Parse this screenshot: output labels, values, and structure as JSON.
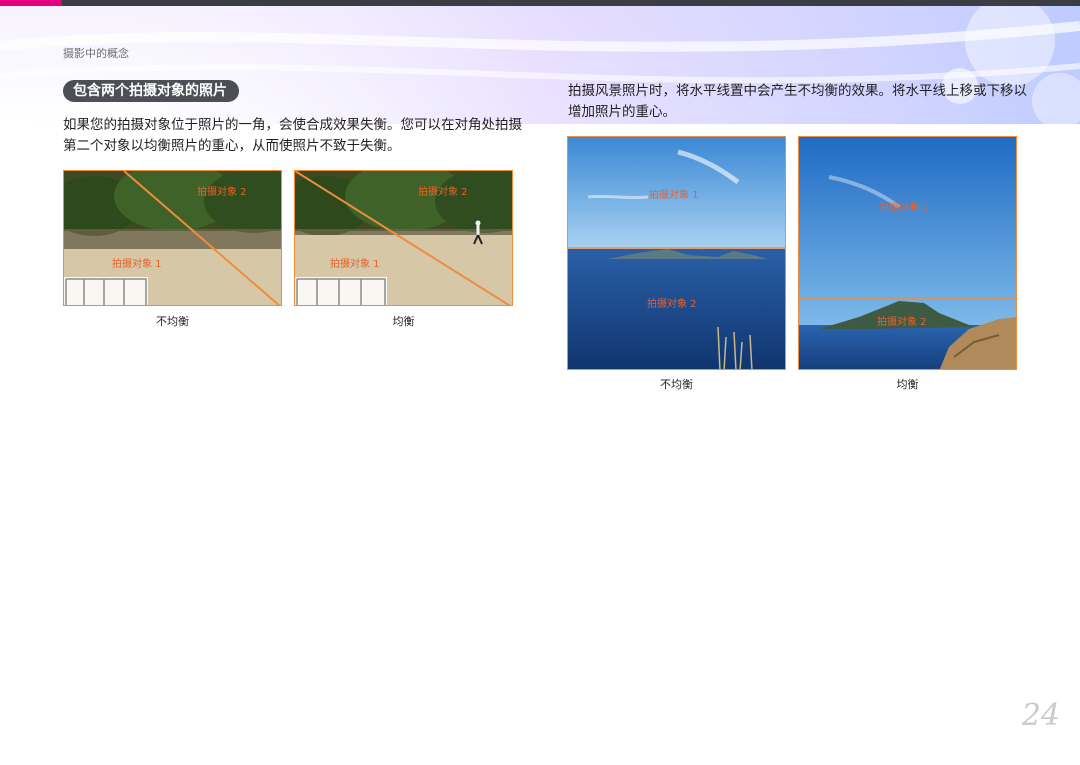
{
  "header": {
    "breadcrumb": "摄影中的概念"
  },
  "section": {
    "title": "包含两个拍摄对象的照片",
    "left_paragraph": "如果您的拍摄对象位于照片的一角，会使合成效果失衡。您可以在对角处拍摄第二个对象以均衡照片的重心，从而使照片不致于失衡。",
    "right_paragraph": "拍摄风景照片时，将水平线置中会产生不均衡的效果。将水平线上移或下移以增加照片的重心。"
  },
  "figures": {
    "field_unbalanced": {
      "label_subject_1": "拍摄对象 1",
      "label_subject_2": "拍摄对象 2",
      "caption": "不均衡"
    },
    "field_balanced": {
      "label_subject_1": "拍摄对象 1",
      "label_subject_2": "拍摄对象 2",
      "caption": "均衡"
    },
    "sea_unbalanced": {
      "label_subject_1": "拍摄对象 1",
      "label_subject_2": "拍摄对象 2",
      "caption": "不均衡"
    },
    "sea_balanced": {
      "label_subject_1": "拍摄对象 1",
      "label_subject_2": "拍摄对象 2",
      "caption": "均衡"
    }
  },
  "page": {
    "number": "24"
  },
  "colors": {
    "accent": "#e4007f",
    "frame": "#f08c3c",
    "label": "#e8612c",
    "pill": "#4d4f57"
  }
}
